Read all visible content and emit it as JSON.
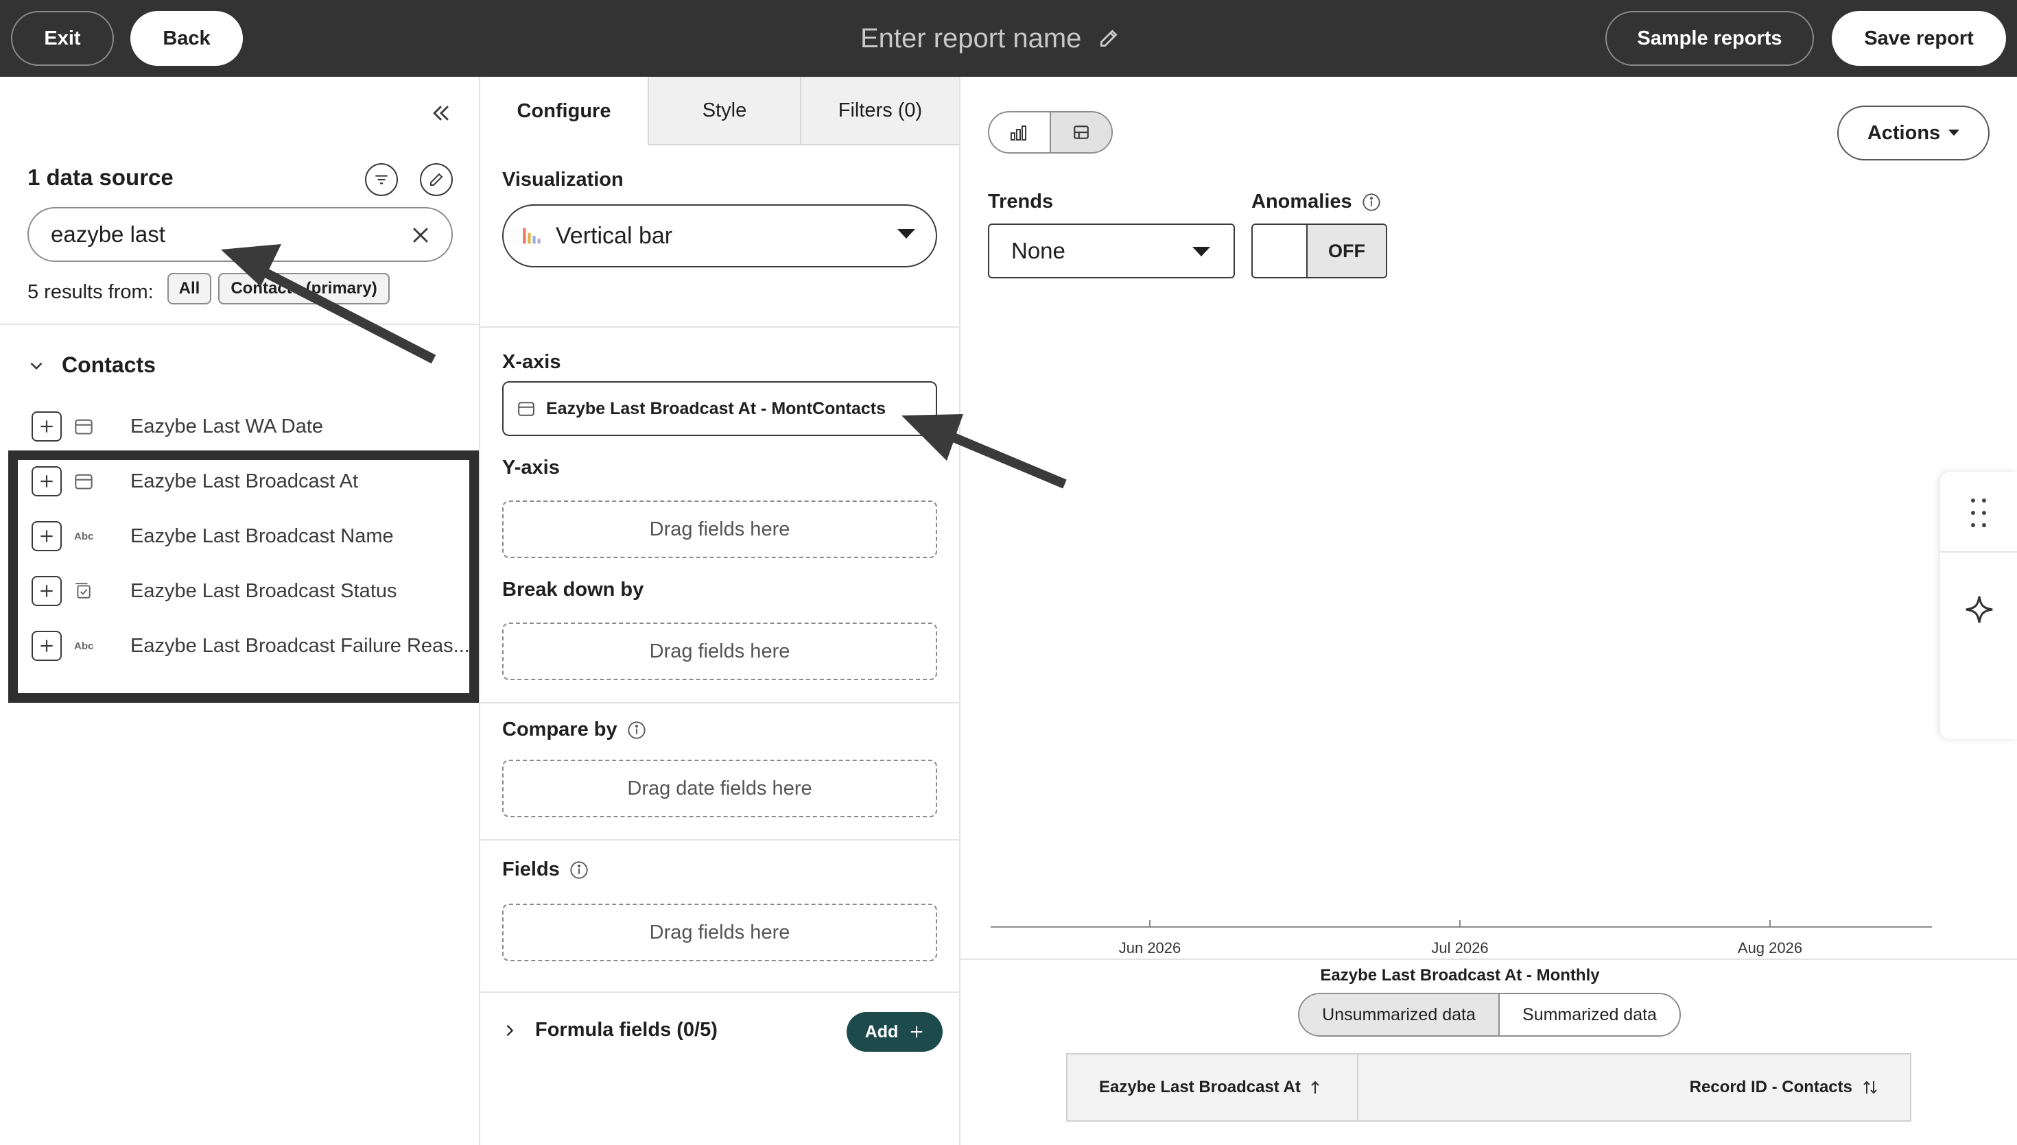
{
  "header": {
    "exit_label": "Exit",
    "back_label": "Back",
    "report_name_placeholder": "Enter report name",
    "sample_reports_label": "Sample reports",
    "save_report_label": "Save report"
  },
  "sidebar": {
    "data_source_title": "1 data source",
    "search_value": "eazybe last",
    "results_text": "5 results from:",
    "filter_chips": [
      "All",
      "Contacts (primary)"
    ],
    "group_label": "Contacts",
    "fields": [
      {
        "label": "Eazybe Last WA Date",
        "type_icon": "calendar-icon",
        "type_text": ""
      },
      {
        "label": "Eazybe Last Broadcast At",
        "type_icon": "calendar-icon",
        "type_text": ""
      },
      {
        "label": "Eazybe Last Broadcast Name",
        "type_icon": "text-type-icon",
        "type_text": "Abc"
      },
      {
        "label": "Eazybe Last Broadcast Status",
        "type_icon": "checkbox-list-icon",
        "type_text": ""
      },
      {
        "label": "Eazybe Last Broadcast Failure Reas...",
        "type_icon": "text-type-icon",
        "type_text": "Abc"
      }
    ]
  },
  "config": {
    "tabs": [
      "Configure",
      "Style",
      "Filters (0)"
    ],
    "visualization_label": "Visualization",
    "visualization_value": "Vertical bar",
    "xaxis_label": "X-axis",
    "xaxis_field": "Eazybe Last Broadcast At - MontContacts",
    "yaxis_label": "Y-axis",
    "yaxis_drop": "Drag fields here",
    "breakdown_label": "Break down by",
    "breakdown_drop": "Drag fields here",
    "compare_label": "Compare by",
    "compare_drop": "Drag date fields here",
    "fields_label": "Fields",
    "fields_drop": "Drag fields here",
    "formula_label": "Formula fields (0/5)",
    "add_label": "Add"
  },
  "chart_area": {
    "actions_label": "Actions",
    "trends_label": "Trends",
    "trends_value": "None",
    "anomalies_label": "Anomalies",
    "anomalies_state": "OFF",
    "data_tabs": [
      "Unsummarized data",
      "Summarized data"
    ],
    "table_columns": [
      "Eazybe Last Broadcast At",
      "Record ID - Contacts"
    ]
  },
  "chart_data": {
    "type": "bar",
    "categories": [
      "Jun 2026",
      "Jul 2026",
      "Aug 2026"
    ],
    "values": [],
    "title": "",
    "xlabel": "Eazybe Last Broadcast At - Monthly",
    "ylabel": ""
  },
  "colors": {
    "topbar": "#333333",
    "accent_button": "#1d4b4d"
  }
}
